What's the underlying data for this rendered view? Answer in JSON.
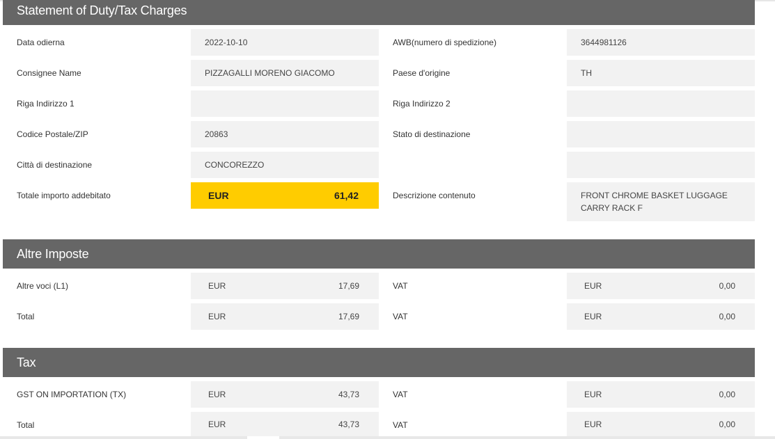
{
  "header": {
    "title": "Statement of Duty/Tax Charges"
  },
  "details": {
    "date_label": "Data odierna",
    "date_value": "2022-10-10",
    "awb_label": "AWB(numero di spedizione)",
    "awb_value": "3644981126",
    "consignee_label": "Consignee Name",
    "consignee_value": "PIZZAGALLI MORENO GIACOMO",
    "origin_label": "Paese d'origine",
    "origin_value": "TH",
    "address1_label": "Riga Indirizzo 1",
    "address1_value": "",
    "address2_label": "Riga Indirizzo 2",
    "address2_value": "",
    "zip_label": "Codice Postale/ZIP",
    "zip_value": "20863",
    "state_label": "Stato di destinazione",
    "state_value": "",
    "city_label": "Città di destinazione",
    "city_value": "CONCOREZZO",
    "extra_value": "",
    "total_label": "Totale importo addebitato",
    "total_currency": "EUR",
    "total_amount": "61,42",
    "description_label": "Descrizione contenuto",
    "description_value": "FRONT CHROME BASKET LUGGAGE CARRY RACK F"
  },
  "other_taxes": {
    "title": "Altre Imposte",
    "rows": [
      {
        "label": "Altre voci (L1)",
        "currency": "EUR",
        "amount": "17,69",
        "vat_label": "VAT",
        "vat_currency": "EUR",
        "vat_amount": "0,00"
      },
      {
        "label": "Total",
        "currency": "EUR",
        "amount": "17,69",
        "vat_label": "VAT",
        "vat_currency": "EUR",
        "vat_amount": "0,00"
      }
    ]
  },
  "tax": {
    "title": "Tax",
    "rows": [
      {
        "label": "GST ON IMPORTATION (TX)",
        "currency": "EUR",
        "amount": "43,73",
        "vat_label": "VAT",
        "vat_currency": "EUR",
        "vat_amount": "0,00"
      },
      {
        "label": "Total",
        "currency": "EUR",
        "amount": "43,73",
        "vat_label": "VAT",
        "vat_currency": "EUR",
        "vat_amount": "0,00"
      }
    ]
  }
}
